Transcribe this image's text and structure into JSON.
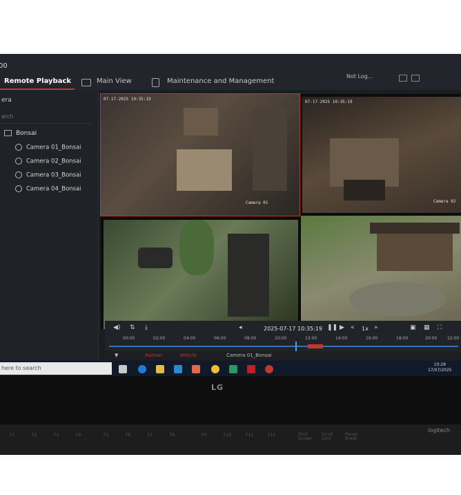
{
  "window": {
    "title_fragment": "00"
  },
  "tabs": [
    {
      "label": "Remote Playback",
      "active": true
    },
    {
      "label": "Main View",
      "active": false
    },
    {
      "label": "Maintenance and Management",
      "active": false
    }
  ],
  "status": {
    "account": "Not Log..."
  },
  "sidebar": {
    "label": "era",
    "search_placeholder": "arch",
    "folder": "Bonsai",
    "cameras": [
      "Camera 01_Bonsai",
      "Camera 02_Bonsai",
      "Camera 03_Bonsai",
      "Camera 04_Bonsai"
    ]
  },
  "tiles": [
    {
      "osd_time": "07-17-2025 10:35:19",
      "osd_name": "Camera 01",
      "selected": true
    },
    {
      "osd_time": "07-17-2025 10:35:19",
      "osd_name": "Camera 02",
      "selected": false
    },
    {
      "osd_time": "",
      "osd_name": "",
      "selected": false
    },
    {
      "osd_time": "",
      "osd_name": "",
      "selected": false
    }
  ],
  "playback": {
    "datetime": "2025-07-17 10:35:19",
    "speed": "1x",
    "ticks": [
      "00:00",
      "02:00",
      "04:00",
      "06:00",
      "08:00",
      "10:00",
      "12:00",
      "14:00",
      "16:00",
      "18:00",
      "20:00",
      "22:00"
    ]
  },
  "filter": {
    "human": "Human",
    "vehicle": "Vehicle",
    "camera": "Camera 01_Bonsai"
  },
  "taskbar": {
    "search_placeholder": "here to search",
    "time": "10:28",
    "date": "17/07/2025"
  },
  "brand": {
    "monitor": "LG",
    "keyboard": "logitech"
  },
  "keys": [
    "F1",
    "F2",
    "F3",
    "F4",
    "F5",
    "F6",
    "F7",
    "F8",
    "F9",
    "F10",
    "F11",
    "F12",
    "Print Screen",
    "Scroll Lock",
    "Pause Break"
  ],
  "colors": {
    "accent": "#c0392b",
    "timeline": "#3a6fb0"
  }
}
